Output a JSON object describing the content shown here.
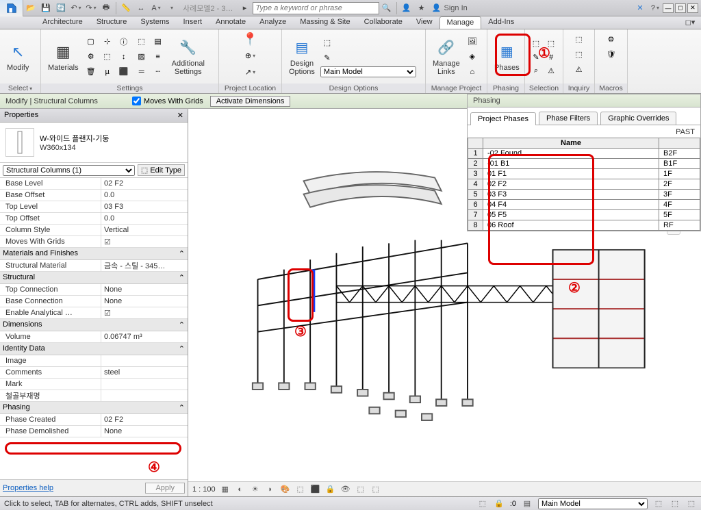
{
  "qat": {
    "doc_title": "사례모델2 - 3…",
    "search_placeholder": "Type a keyword or phrase",
    "sign_in": "Sign In"
  },
  "tabs": [
    "Architecture",
    "Structure",
    "Systems",
    "Insert",
    "Annotate",
    "Analyze",
    "Massing & Site",
    "Collaborate",
    "View",
    "Manage",
    "Add-Ins"
  ],
  "active_tab": "Manage",
  "ribbon": {
    "modify": "Modify",
    "select_label": "Select",
    "materials": "Materials",
    "additional_settings": "Additional\nSettings",
    "settings_label": "Settings",
    "project_location": "Project Location",
    "design_options_btn": "Design\nOptions",
    "design_options_label": "Design Options",
    "main_model_sel": "Main Model",
    "manage_links": "Manage\nLinks",
    "manage_project": "Manage Project",
    "phases": "Phases",
    "phasing_label": "Phasing",
    "selection_label": "Selection",
    "inquiry_label": "Inquiry",
    "macros_label": "Macros"
  },
  "options_bar": {
    "context": "Modify | Structural Columns",
    "moves_with_grids": "Moves With Grids",
    "activate_dims": "Activate Dimensions"
  },
  "properties": {
    "title": "Properties",
    "type_name": "W-와이드 플랜지-기둥",
    "type_size": "W360x134",
    "category": "Structural Columns (1)",
    "edit_type": "Edit Type",
    "groups": [
      {
        "name": "",
        "rows": [
          {
            "n": "Base Level",
            "v": "02 F2"
          },
          {
            "n": "Base Offset",
            "v": "0.0"
          },
          {
            "n": "Top Level",
            "v": "03 F3"
          },
          {
            "n": "Top Offset",
            "v": "0.0"
          },
          {
            "n": "Column Style",
            "v": "Vertical"
          },
          {
            "n": "Moves With Grids",
            "v": "☑"
          }
        ]
      },
      {
        "name": "Materials and Finishes",
        "rows": [
          {
            "n": "Structural Material",
            "v": "금속 - 스틸 - 345…"
          }
        ]
      },
      {
        "name": "Structural",
        "rows": [
          {
            "n": "Top Connection",
            "v": "None"
          },
          {
            "n": "Base Connection",
            "v": "None"
          },
          {
            "n": "Enable Analytical …",
            "v": "☑"
          }
        ]
      },
      {
        "name": "Dimensions",
        "rows": [
          {
            "n": "Volume",
            "v": "0.06747 m³"
          }
        ]
      },
      {
        "name": "Identity Data",
        "rows": [
          {
            "n": "Image",
            "v": ""
          },
          {
            "n": "Comments",
            "v": "steel"
          },
          {
            "n": "Mark",
            "v": ""
          },
          {
            "n": "철골부재명",
            "v": ""
          }
        ]
      },
      {
        "name": "Phasing",
        "rows": [
          {
            "n": "Phase Created",
            "v": "02 F2"
          },
          {
            "n": "Phase Demolished",
            "v": "None"
          }
        ]
      }
    ],
    "help": "Properties help",
    "apply": "Apply"
  },
  "phasing_panel": {
    "title": "Phasing",
    "tabs": [
      "Project Phases",
      "Phase Filters",
      "Graphic Overrides"
    ],
    "active": "Project Phases",
    "past": "PAST",
    "header_name": "Name",
    "rows": [
      {
        "i": "1",
        "n": "-02 Found",
        "d": "B2F"
      },
      {
        "i": "2",
        "n": "-01 B1",
        "d": "B1F"
      },
      {
        "i": "3",
        "n": "01 F1",
        "d": "1F"
      },
      {
        "i": "4",
        "n": "02 F2",
        "d": "2F"
      },
      {
        "i": "5",
        "n": "03 F3",
        "d": "3F"
      },
      {
        "i": "6",
        "n": "04 F4",
        "d": "4F"
      },
      {
        "i": "7",
        "n": "05 F5",
        "d": "5F"
      },
      {
        "i": "8",
        "n": "06 Roof",
        "d": "RF"
      }
    ]
  },
  "view_controls": {
    "scale": "1 : 100",
    "main_model": "Main Model"
  },
  "status_bar": {
    "hint": "Click to select, TAB for alternates, CTRL adds, SHIFT unselect"
  },
  "annotations": {
    "n1": "①",
    "n2": "②",
    "n3": "③",
    "n4": "④"
  }
}
